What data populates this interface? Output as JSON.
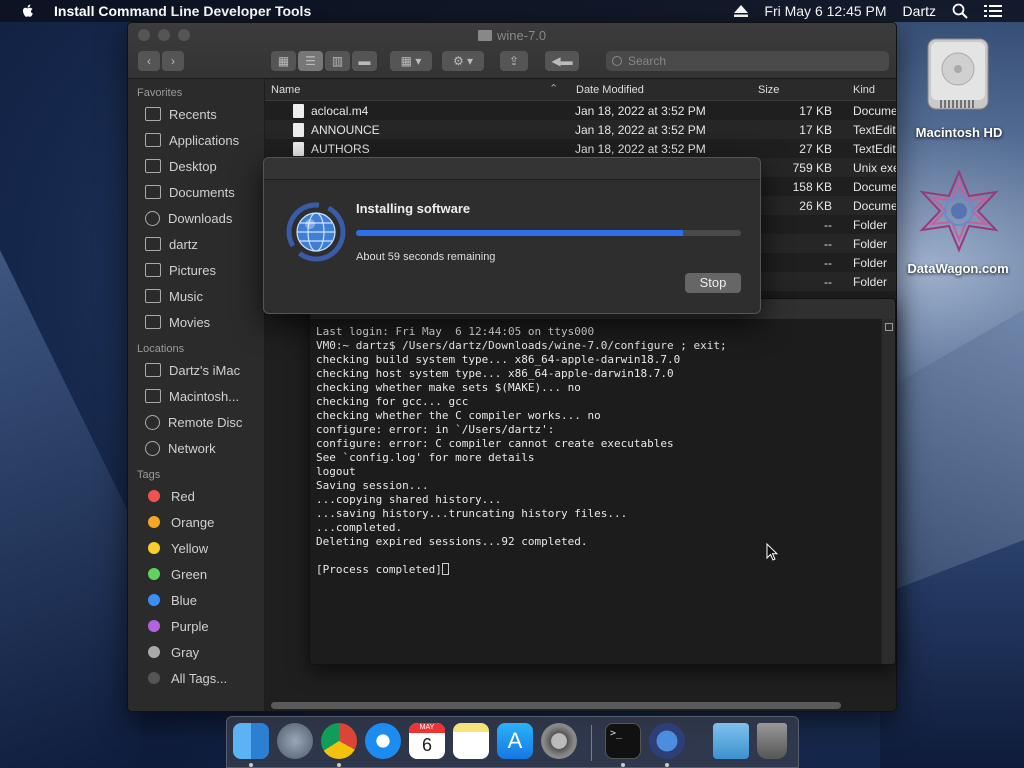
{
  "menubar": {
    "app_title": "Install Command Line Developer Tools",
    "datetime": "Fri May 6  12:45 PM",
    "user": "Dartz"
  },
  "finder": {
    "window_title": "wine-7.0",
    "search_placeholder": "Search",
    "sidebar": {
      "favorites_header": "Favorites",
      "favorites": [
        "Recents",
        "Applications",
        "Desktop",
        "Documents",
        "Downloads",
        "dartz",
        "Pictures",
        "Music",
        "Movies"
      ],
      "locations_header": "Locations",
      "locations": [
        "Dartz's iMac",
        "Macintosh...",
        "Remote Disc",
        "Network"
      ],
      "tags_header": "Tags",
      "tags": [
        {
          "label": "Red",
          "color": "#ef5350"
        },
        {
          "label": "Orange",
          "color": "#f5a623"
        },
        {
          "label": "Yellow",
          "color": "#f7d02c"
        },
        {
          "label": "Green",
          "color": "#5ed35e"
        },
        {
          "label": "Blue",
          "color": "#3a8ef6"
        },
        {
          "label": "Purple",
          "color": "#b462e0"
        },
        {
          "label": "Gray",
          "color": "#a9a9a9"
        },
        {
          "label": "All Tags...",
          "color": "#555555"
        }
      ]
    },
    "columns": {
      "name": "Name",
      "date": "Date Modified",
      "size": "Size",
      "kind": "Kind"
    },
    "files": [
      {
        "name": "aclocal.m4",
        "date": "Jan 18, 2022 at 3:52 PM",
        "size": "17 KB",
        "kind": "Docume"
      },
      {
        "name": "ANNOUNCE",
        "date": "Jan 18, 2022 at 3:52 PM",
        "size": "17 KB",
        "kind": "TextEdit"
      },
      {
        "name": "AUTHORS",
        "date": "Jan 18, 2022 at 3:52 PM",
        "size": "27 KB",
        "kind": "TextEdit"
      },
      {
        "name": "",
        "date": "",
        "size": "759 KB",
        "kind": "Unix exe"
      },
      {
        "name": "",
        "date": "",
        "size": "158 KB",
        "kind": "Docume"
      },
      {
        "name": "",
        "date": "",
        "size": "26 KB",
        "kind": "Docume"
      },
      {
        "name": "",
        "date": "",
        "size": "--",
        "kind": "Folder"
      },
      {
        "name": "",
        "date": "",
        "size": "--",
        "kind": "Folder"
      },
      {
        "name": "",
        "date": "",
        "size": "--",
        "kind": "Folder"
      },
      {
        "name": "",
        "date": "",
        "size": "--",
        "kind": "Folder"
      }
    ]
  },
  "dialog": {
    "title": "Installing software",
    "remaining": "About 59 seconds remaining",
    "stop_label": "Stop",
    "progress": 0.85
  },
  "terminal": {
    "lines": [
      "Last login: Fri May  6 12:44:05 on ttys000",
      "VM0:~ dartz$ /Users/dartz/Downloads/wine-7.0/configure ; exit;",
      "checking build system type... x86_64-apple-darwin18.7.0",
      "checking host system type... x86_64-apple-darwin18.7.0",
      "checking whether make sets $(MAKE)... no",
      "checking for gcc... gcc",
      "checking whether the C compiler works... no",
      "configure: error: in `/Users/dartz':",
      "configure: error: C compiler cannot create executables",
      "See `config.log' for more details",
      "logout",
      "Saving session...",
      "...copying shared history...",
      "...saving history...truncating history files...",
      "...completed.",
      "Deleting expired sessions...92 completed.",
      "",
      "[Process completed]"
    ]
  },
  "desktop": {
    "hd_label": "Macintosh HD",
    "datawagon_label": "DataWagon.com"
  },
  "dock": {
    "icons": [
      "finder-icon",
      "launchpad-icon",
      "chrome-icon",
      "safari-icon",
      "calendar-icon",
      "notes-icon",
      "app-store-icon",
      "system-preferences-icon",
      "terminal-icon",
      "installer-icon",
      "downloads-folder-icon",
      "trash-icon"
    ],
    "calendar_month": "MAY",
    "calendar_day": "6"
  }
}
